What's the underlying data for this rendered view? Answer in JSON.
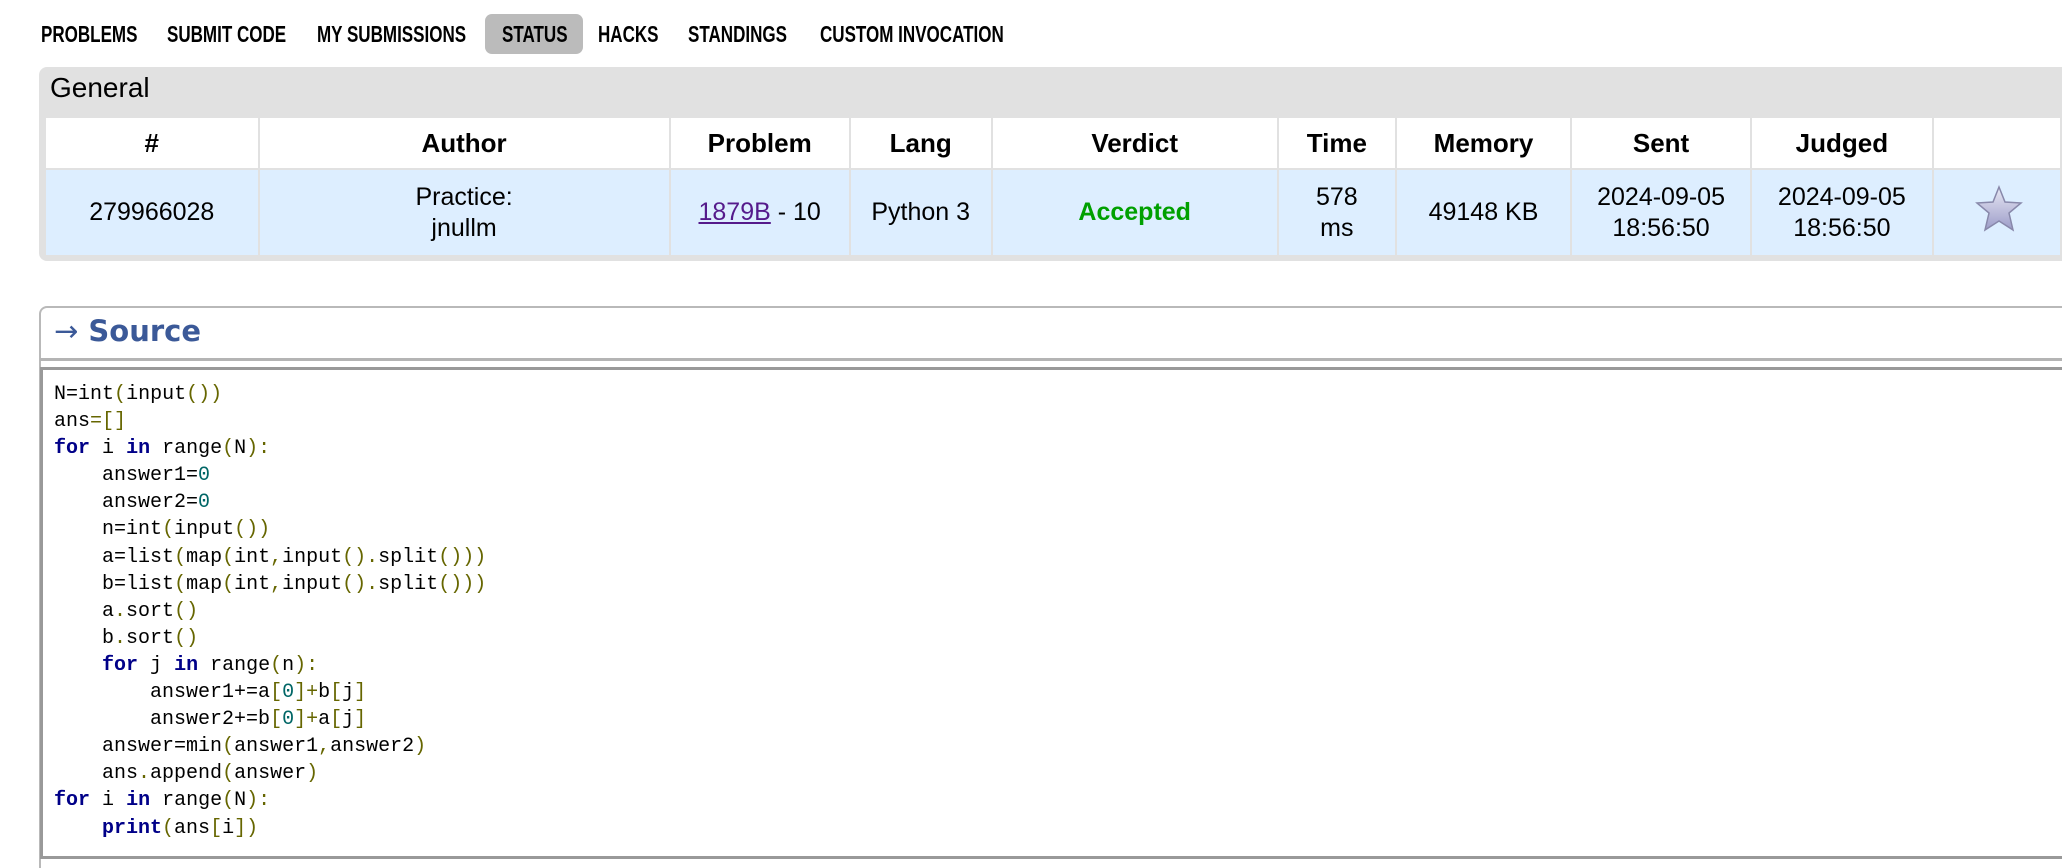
{
  "nav": {
    "items": [
      "PROBLEMS",
      "SUBMIT CODE",
      "MY SUBMISSIONS",
      "STATUS",
      "HACKS",
      "STANDINGS",
      "CUSTOM INVOCATION"
    ],
    "active": "STATUS"
  },
  "general": {
    "title": "General",
    "headers": [
      "#",
      "Author",
      "Problem",
      "Lang",
      "Verdict",
      "Time",
      "Memory",
      "Sent",
      "Judged",
      ""
    ],
    "row": {
      "id": "279966028",
      "author_line1": "Practice:",
      "author_line2": "jnullm",
      "problem_link": "1879B",
      "problem_suffix": " - 10",
      "lang": "Python 3",
      "verdict": "Accepted",
      "time_value": "578",
      "time_unit": "ms",
      "memory": "49148 KB",
      "sent_date": "2024-09-05",
      "sent_time": "18:56:50",
      "judged_date": "2024-09-05",
      "judged_time": "18:56:50",
      "favorite_icon": "star-icon"
    }
  },
  "source": {
    "arrow": "→",
    "title": "Source",
    "code": [
      "N=int(input())",
      "ans=[]",
      "for i in range(N):",
      "    answer1=0",
      "    answer2=0",
      "    n=int(input())",
      "    a=list(map(int,input().split()))",
      "    b=list(map(int,input().split()))",
      "    a.sort()",
      "    b.sort()",
      "    for j in range(n):",
      "        answer1+=a[0]+b[j]",
      "        answer2+=b[0]+a[j]",
      "    answer=min(answer1,answer2)",
      "    ans.append(answer)",
      "for i in range(N):",
      "    print(ans[i])"
    ]
  },
  "colors": {
    "verdict_accepted": "#00a000",
    "row_bg": "#ddeeff",
    "source_title": "#3b5998",
    "keyword": "#000088"
  }
}
